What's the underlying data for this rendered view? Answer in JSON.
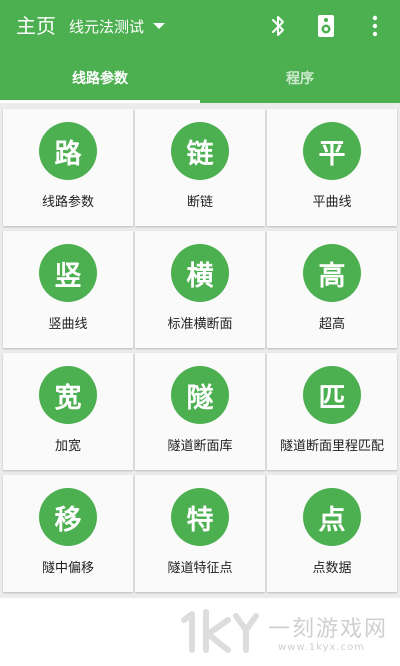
{
  "appbar": {
    "title": "主页",
    "project_name": "线元法测试",
    "icons": [
      "bluetooth-icon",
      "speaker-icon",
      "more-vert-icon"
    ]
  },
  "tabs": [
    {
      "label": "线路参数",
      "selected": true
    },
    {
      "label": "程序",
      "selected": false
    }
  ],
  "grid": [
    {
      "glyph": "路",
      "label": "线路参数"
    },
    {
      "glyph": "链",
      "label": "断链"
    },
    {
      "glyph": "平",
      "label": "平曲线"
    },
    {
      "glyph": "竖",
      "label": "竖曲线"
    },
    {
      "glyph": "横",
      "label": "标准横断面"
    },
    {
      "glyph": "高",
      "label": "超高"
    },
    {
      "glyph": "宽",
      "label": "加宽"
    },
    {
      "glyph": "隧",
      "label": "隧道断面库"
    },
    {
      "glyph": "匹",
      "label": "隧道断面里程匹配"
    },
    {
      "glyph": "移",
      "label": "隧中偏移"
    },
    {
      "glyph": "特",
      "label": "隧道特征点"
    },
    {
      "glyph": "点",
      "label": "点数据"
    }
  ],
  "watermark": {
    "text": "一刻游戏网",
    "url": "www.1kyx.com"
  },
  "colors": {
    "primary": "#4caf50",
    "background": "#ececec",
    "card": "#fafafa"
  }
}
